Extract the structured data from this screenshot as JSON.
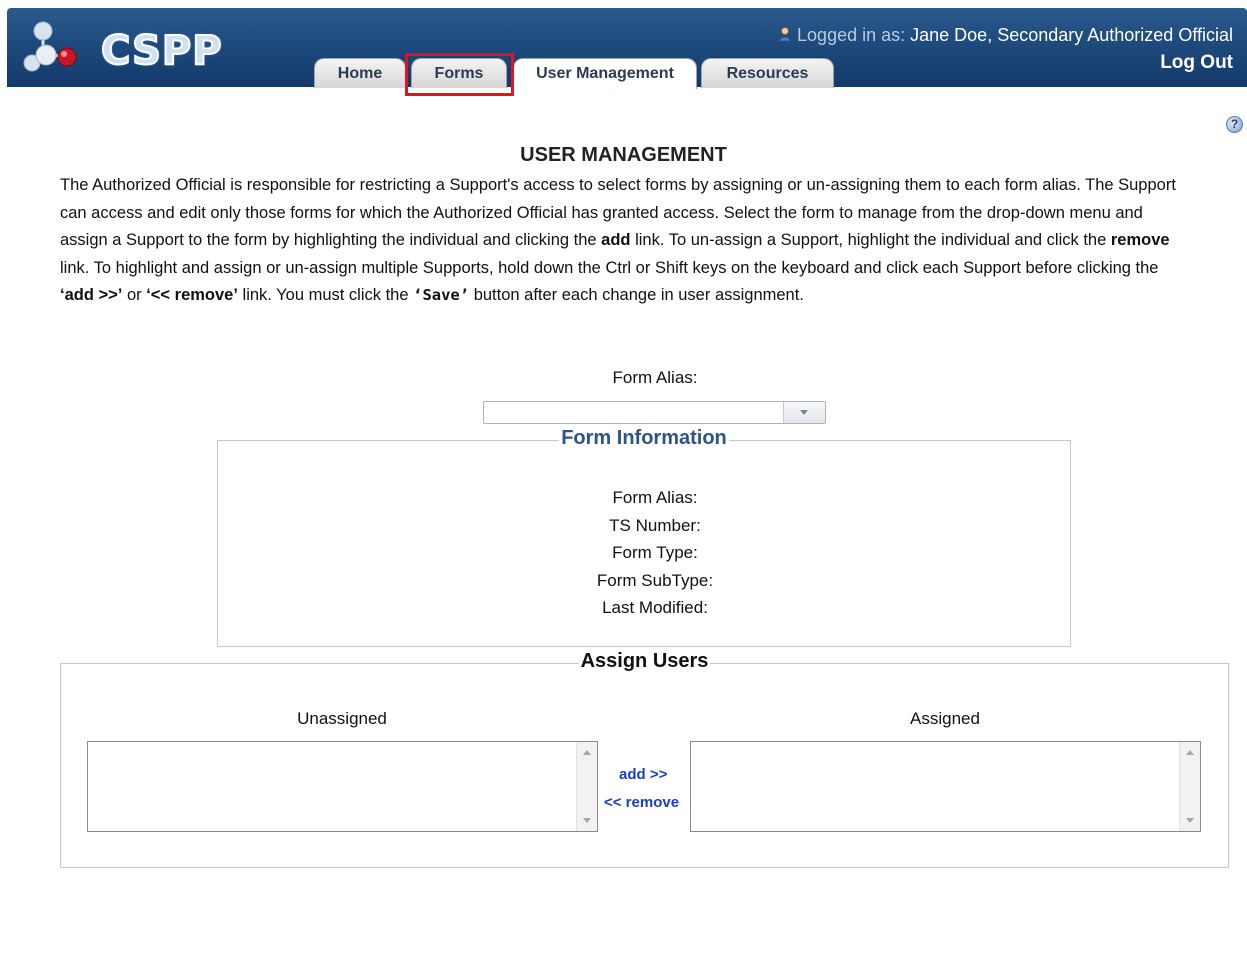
{
  "header": {
    "logo_text": "CSPP",
    "logged_in_prefix": "Logged in as:",
    "logged_in_user": "Jane Doe, Secondary Authorized Official",
    "logout_label": "Log Out"
  },
  "tabs": [
    {
      "label": "Home",
      "active": false
    },
    {
      "label": "Forms",
      "active": false,
      "highlighted": true
    },
    {
      "label": "User Management",
      "active": true
    },
    {
      "label": "Resources",
      "active": false
    }
  ],
  "help_icon": "?",
  "page": {
    "title": "USER MANAGEMENT",
    "intro": {
      "p1": "The Authorized Official is responsible for restricting a Support's access to select forms by assigning or un-assigning them to each form alias. The Support can access and edit only those forms for which the Authorized Official has granted access. Select the form to manage from the drop-down menu and assign a Support to the form by highlighting the individual and clicking the ",
      "b1": "add",
      "p2": " link. To un-assign a Support, highlight the individual and click the ",
      "b2": "remove",
      "p3": " link. To highlight and assign or un-assign multiple Supports, hold down the Ctrl or Shift keys on the keyboard and click each Support before clicking the ",
      "b3": "‘add >>’",
      "p4": " or ",
      "b4": "‘<< remove’",
      "p5": " link. You must click the ",
      "b5": "‘Save’",
      "p6": " button after each change in user assignment."
    },
    "form_alias_label": "Form Alias:",
    "form_alias_value": "",
    "form_information": {
      "legend": "Form Information",
      "rows": [
        "Form Alias:",
        "TS Number:",
        "Form Type:",
        "Form SubType:",
        "Last Modified:"
      ]
    },
    "assign_users": {
      "legend": "Assign Users",
      "unassigned_label": "Unassigned",
      "assigned_label": "Assigned",
      "add_link": "add >>",
      "remove_link": "<< remove"
    }
  },
  "colors": {
    "header_blue": "#1e4a7d",
    "highlight_red": "#e0141e",
    "link_blue": "#1a3dc8",
    "legend_blue": "#2c5584"
  }
}
